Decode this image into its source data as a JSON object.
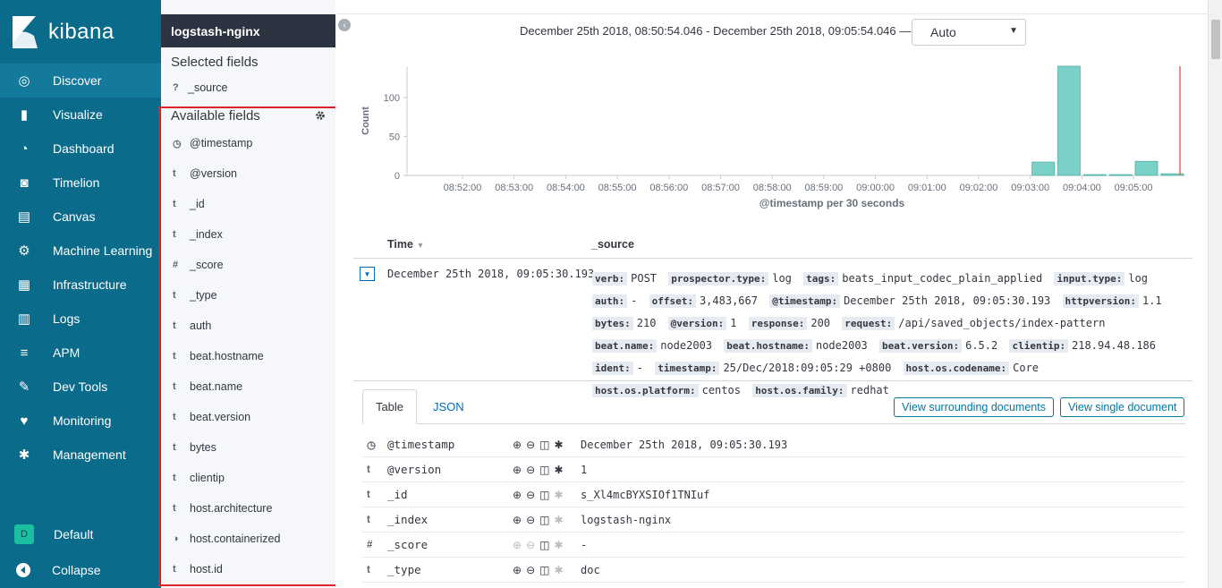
{
  "nav": {
    "brand": "kibana",
    "items": [
      {
        "label": "Discover",
        "icon": "compass-icon"
      },
      {
        "label": "Visualize",
        "icon": "bar-chart-icon"
      },
      {
        "label": "Dashboard",
        "icon": "gauge-icon"
      },
      {
        "label": "Timelion",
        "icon": "timelion-icon"
      },
      {
        "label": "Canvas",
        "icon": "canvas-icon"
      },
      {
        "label": "Machine Learning",
        "icon": "ml-icon"
      },
      {
        "label": "Infrastructure",
        "icon": "infra-icon"
      },
      {
        "label": "Logs",
        "icon": "logs-icon"
      },
      {
        "label": "APM",
        "icon": "apm-icon"
      },
      {
        "label": "Dev Tools",
        "icon": "wrench-icon"
      },
      {
        "label": "Monitoring",
        "icon": "heartbeat-icon"
      },
      {
        "label": "Management",
        "icon": "gear-icon"
      }
    ],
    "space_badge": "D",
    "space_label": "Default",
    "collapse_label": "Collapse"
  },
  "sidebar": {
    "index_pattern": "logstash-nginx",
    "selected_title": "Selected fields",
    "selected_fields": [
      {
        "type": "?",
        "name": "_source"
      }
    ],
    "available_title": "Available fields",
    "available_fields": [
      {
        "type": "clock",
        "name": "@timestamp"
      },
      {
        "type": "t",
        "name": "@version"
      },
      {
        "type": "t",
        "name": "_id"
      },
      {
        "type": "t",
        "name": "_index"
      },
      {
        "type": "#",
        "name": "_score"
      },
      {
        "type": "t",
        "name": "_type"
      },
      {
        "type": "t",
        "name": "auth"
      },
      {
        "type": "t",
        "name": "beat.hostname"
      },
      {
        "type": "t",
        "name": "beat.name"
      },
      {
        "type": "t",
        "name": "beat.version"
      },
      {
        "type": "t",
        "name": "bytes"
      },
      {
        "type": "t",
        "name": "clientip"
      },
      {
        "type": "t",
        "name": "host.architecture"
      },
      {
        "type": "bool",
        "name": "host.containerized"
      },
      {
        "type": "t",
        "name": "host.id"
      }
    ]
  },
  "header": {
    "time_range": "December 25th 2018, 08:50:54.046 - December 25th 2018, 09:05:54.046 —",
    "interval": "Auto"
  },
  "chart_data": {
    "type": "bar",
    "ylabel": "Count",
    "xlabel": "@timestamp per 30 seconds",
    "x_ticks": [
      "08:52:00",
      "08:53:00",
      "08:54:00",
      "08:55:00",
      "08:56:00",
      "08:57:00",
      "08:58:00",
      "08:59:00",
      "09:00:00",
      "09:01:00",
      "09:02:00",
      "09:03:00",
      "09:04:00",
      "09:05:00"
    ],
    "y_ticks": [
      0,
      50,
      100
    ],
    "ylim": [
      0,
      140
    ],
    "categories": [
      "09:03:00",
      "09:03:30",
      "09:04:00",
      "09:04:30",
      "09:05:00",
      "09:05:30"
    ],
    "values": [
      17,
      140,
      1,
      1,
      18,
      2
    ],
    "bar_color": "#79d1c7",
    "marker_color": "#e7664c"
  },
  "documents": {
    "col_time": "Time",
    "col_source": "_source",
    "row_time": "December 25th 2018, 09:05:30.193",
    "source_pairs": [
      {
        "k": "verb:",
        "v": "POST"
      },
      {
        "k": "prospector.type:",
        "v": "log"
      },
      {
        "k": "tags:",
        "v": "beats_input_codec_plain_applied"
      },
      {
        "k": "input.type:",
        "v": "log"
      },
      {
        "k": "auth:",
        "v": "-"
      },
      {
        "k": "offset:",
        "v": "3,483,667"
      },
      {
        "k": "@timestamp:",
        "v": "December 25th 2018, 09:05:30.193"
      },
      {
        "k": "httpversion:",
        "v": "1.1"
      },
      {
        "k": "bytes:",
        "v": "210"
      },
      {
        "k": "@version:",
        "v": "1"
      },
      {
        "k": "response:",
        "v": "200"
      },
      {
        "k": "request:",
        "v": "/api/saved_objects/index-pattern"
      },
      {
        "k": "beat.name:",
        "v": "node2003"
      },
      {
        "k": "beat.hostname:",
        "v": "node2003"
      },
      {
        "k": "beat.version:",
        "v": "6.5.2"
      },
      {
        "k": "clientip:",
        "v": "218.94.48.186"
      },
      {
        "k": "ident:",
        "v": "-"
      },
      {
        "k": "timestamp:",
        "v": "25/Dec/2018:09:05:29 +0800"
      },
      {
        "k": "host.os.codename:",
        "v": "Core"
      },
      {
        "k": "host.os.platform:",
        "v": "centos"
      },
      {
        "k": "host.os.family:",
        "v": "redhat"
      }
    ]
  },
  "detail": {
    "tab_table": "Table",
    "tab_json": "JSON",
    "btn_surrounding": "View surrounding documents",
    "btn_single": "View single document",
    "rows": [
      {
        "type": "clock",
        "name": "@timestamp",
        "value": "December 25th 2018, 09:05:30.193",
        "dim": false
      },
      {
        "type": "t",
        "name": "@version",
        "value": "1",
        "dim": false
      },
      {
        "type": "t",
        "name": "_id",
        "value": "s_Xl4mcBYXSIOf1TNIuf",
        "dim": true
      },
      {
        "type": "t",
        "name": "_index",
        "value": "logstash-nginx",
        "dim": true
      },
      {
        "type": "#",
        "name": "_score",
        "value": " -",
        "dim": true
      },
      {
        "type": "t",
        "name": "_type",
        "value": "doc",
        "dim": true
      }
    ]
  }
}
